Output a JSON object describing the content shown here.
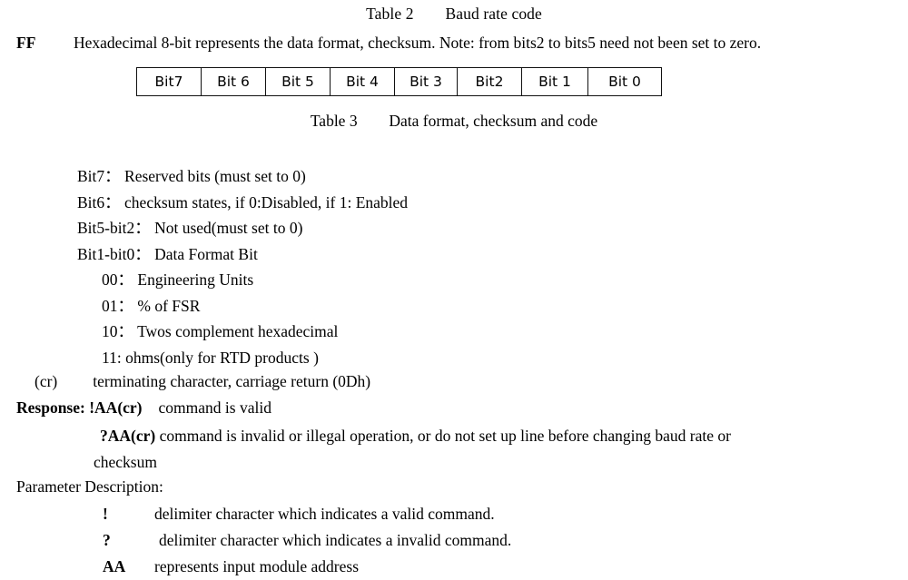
{
  "table2": {
    "caption_label": "Table 2",
    "caption_text": "Baud rate code"
  },
  "ff_row": {
    "label": "FF",
    "text": "Hexadecimal 8-bit represents the data format, checksum. Note: from bits2 to bits5 need not been set to zero."
  },
  "bit_table": {
    "cells": [
      "Bit7",
      "Bit 6",
      "Bit 5",
      "Bit 4",
      "Bit 3",
      "Bit2",
      "Bit 1",
      "Bit 0"
    ]
  },
  "table3": {
    "caption_label": "Table 3",
    "caption_text": "Data format, checksum and code"
  },
  "bit_descriptions": [
    {
      "key": "Bit7：",
      "desc": "Reserved bits (must set to 0)"
    },
    {
      "key": "Bit6：",
      "desc": "checksum states, if 0:Disabled, if 1: Enabled"
    },
    {
      "key": "Bit5-bit2：",
      "desc": "Not used(must set to 0)"
    },
    {
      "key": "Bit1-bit0：",
      "desc": "Data Format Bit"
    }
  ],
  "format_codes": [
    {
      "code": "00：",
      "desc": "Engineering Units"
    },
    {
      "code": "01：",
      "desc": "% of FSR"
    },
    {
      "code": "10：",
      "desc": "Twos complement hexadecimal"
    },
    {
      "code": "11:",
      "desc": "ohms(only for RTD products )"
    }
  ],
  "cr_line": {
    "symbol": "(cr)",
    "desc": "terminating character, carriage return (0Dh)"
  },
  "response": {
    "label": "Response:",
    "valid_command": "!AA(cr)",
    "valid_desc": "command is valid",
    "invalid_command": "?AA(cr)",
    "invalid_desc": "command is invalid or illegal operation, or do not set up line before changing baud rate or",
    "invalid_desc_cont": "checksum"
  },
  "parameter_description": {
    "title": "Parameter Description:",
    "items": [
      {
        "symbol": "!",
        "desc": "delimiter character which indicates a valid command."
      },
      {
        "symbol": "?",
        "desc": "delimiter character which indicates a invalid command."
      },
      {
        "symbol": "AA",
        "desc": "represents input module address"
      }
    ]
  }
}
